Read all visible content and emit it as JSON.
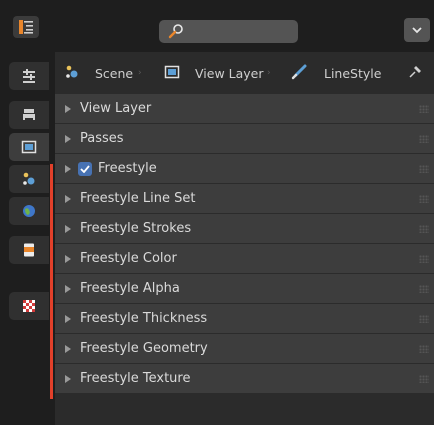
{
  "header": {
    "search": {
      "placeholder": "",
      "value": ""
    }
  },
  "sidebar": {
    "tabs": [
      {
        "name": "tool-tab",
        "icon": "tool-icon"
      },
      {
        "name": "render-tab",
        "icon": "render-icon"
      },
      {
        "name": "view-layer-tab",
        "icon": "view-layer-icon",
        "active": true
      },
      {
        "name": "scene-tab",
        "icon": "scene-icon"
      },
      {
        "name": "world-tab",
        "icon": "world-icon"
      },
      {
        "name": "collection-tab",
        "icon": "collection-icon"
      },
      {
        "name": "texture-tab",
        "icon": "texture-icon"
      }
    ]
  },
  "breadcrumb": {
    "items": [
      {
        "label": "Scene",
        "icon": "scene-icon"
      },
      {
        "label": "View Layer",
        "icon": "view-layer-icon"
      },
      {
        "label": "LineStyle",
        "icon": "brush-icon"
      }
    ],
    "pin_icon": "pin-icon"
  },
  "panels": [
    {
      "label": "View Layer"
    },
    {
      "label": "Passes"
    },
    {
      "label": "Freestyle",
      "checkbox": true,
      "checked": true
    },
    {
      "label": "Freestyle Line Set"
    },
    {
      "label": "Freestyle Strokes"
    },
    {
      "label": "Freestyle Color"
    },
    {
      "label": "Freestyle Alpha"
    },
    {
      "label": "Freestyle Thickness"
    },
    {
      "label": "Freestyle Geometry"
    },
    {
      "label": "Freestyle Texture"
    }
  ],
  "colors": {
    "accent": "#4772b3",
    "highlight_bar": "#e2402a",
    "panel_bg": "#3d3d3d",
    "header_bg": "#1e1e1e"
  }
}
